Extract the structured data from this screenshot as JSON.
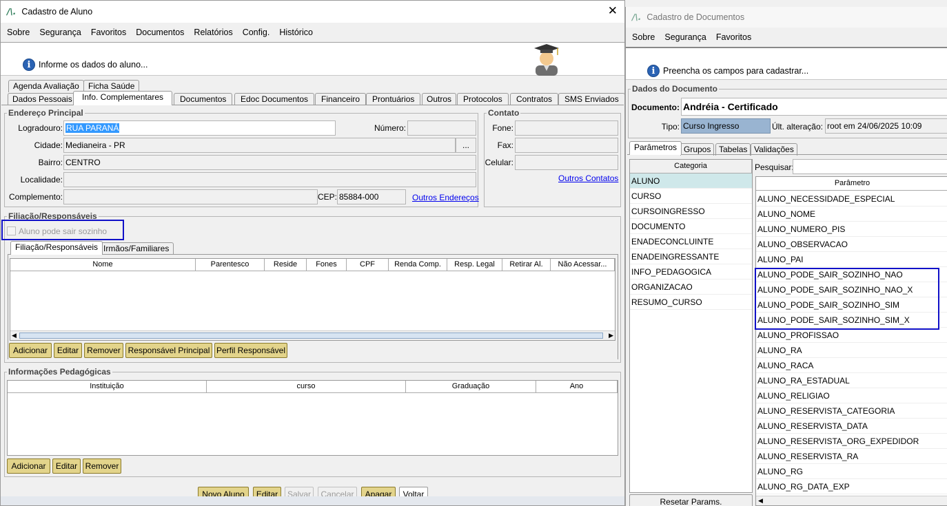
{
  "left": {
    "title": "Cadastro de Aluno",
    "menu": [
      "Sobre",
      "Segurança",
      "Favoritos",
      "Documentos",
      "Relatórios",
      "Config.",
      "Histórico"
    ],
    "banner_text": "Informe os dados do aluno...",
    "tabs_row1": [
      "Agenda Avaliação",
      "Ficha Saúde"
    ],
    "tabs_row2": [
      "Dados Pessoais",
      "Info. Complementares",
      "Documentos",
      "Edoc Documentos",
      "Financeiro",
      "Prontuários",
      "Outros",
      "Protocolos",
      "Contratos",
      "SMS Enviados"
    ],
    "endereco": {
      "legend": "Endereço Principal",
      "logradouro_label": "Logradouro:",
      "logradouro": "RUA PARANÁ",
      "numero_label": "Número:",
      "numero": "",
      "cidade_label": "Cidade:",
      "cidade": "Medianeira - PR",
      "cidade_btn": "...",
      "bairro_label": "Bairro:",
      "bairro": "CENTRO",
      "localidade_label": "Localidade:",
      "localidade": "",
      "complemento_label": "Complemento:",
      "complemento": "",
      "cep_label": "CEP:",
      "cep": "85884-000",
      "outros_enderecos": "Outros Endereços"
    },
    "contato": {
      "legend": "Contato",
      "fone_label": "Fone:",
      "fax_label": "Fax:",
      "celular_label": "Celular:",
      "outros_contatos": "Outros Contatos"
    },
    "filiacao": {
      "legend": "Filiação/Responsáveis",
      "checkbox_label": "Aluno pode sair sozinho",
      "tabs": [
        "Filiação/Responsáveis",
        "Irmãos/Familiares"
      ],
      "columns": [
        "Nome",
        "Parentesco",
        "Reside",
        "Fones",
        "CPF",
        "Renda Comp.",
        "Resp. Legal",
        "Retirar Al.",
        "Não Acessar..."
      ],
      "buttons": [
        "Adicionar",
        "Editar",
        "Remover",
        "Responsável Principal",
        "Perfil Responsável"
      ]
    },
    "pedagogicas": {
      "legend": "Informações Pedagógicas",
      "columns": [
        "Instituição",
        "curso",
        "Graduação",
        "Ano"
      ],
      "buttons": [
        "Adicionar",
        "Editar",
        "Remover"
      ]
    },
    "footer_buttons": [
      "Novo Aluno",
      "Editar",
      "Salvar",
      "Cancelar",
      "Apagar",
      "Voltar"
    ]
  },
  "right": {
    "title": "Cadastro de Documentos",
    "menu": [
      "Sobre",
      "Segurança",
      "Favoritos"
    ],
    "banner_text": "Preencha os campos para cadastrar...",
    "legend": "Dados do Documento",
    "documento_label": "Documento:",
    "documento": "Andréia - Certificado",
    "tipo_label": "Tipo:",
    "tipo": "Curso Ingresso",
    "ult_label": "Últ. alteração:",
    "ult": "root em 24/06/2025 10:09",
    "tabs": [
      "Parâmetros",
      "Grupos",
      "Tabelas",
      "Validações"
    ],
    "categoria_header": "Categoria",
    "categorias": [
      "ALUNO",
      "CURSO",
      "CURSOINGRESSO",
      "DOCUMENTO",
      "ENADECONCLUINTE",
      "ENADEINGRESSANTE",
      "INFO_PEDAGOGICA",
      "ORGANIZACAO",
      "RESUMO_CURSO"
    ],
    "pesquisar_label": "Pesquisar:",
    "parametro_header": "Parâmetro",
    "parametros": [
      "ALUNO_NECESSIDADE_ESPECIAL",
      "ALUNO_NOME",
      "ALUNO_NUMERO_PIS",
      "ALUNO_OBSERVACAO",
      "ALUNO_PAI",
      "ALUNO_PODE_SAIR_SOZINHO_NAO",
      "ALUNO_PODE_SAIR_SOZINHO_NAO_X",
      "ALUNO_PODE_SAIR_SOZINHO_SIM",
      "ALUNO_PODE_SAIR_SOZINHO_SIM_X",
      "ALUNO_PROFISSAO",
      "ALUNO_RA",
      "ALUNO_RACA",
      "ALUNO_RA_ESTADUAL",
      "ALUNO_RELIGIAO",
      "ALUNO_RESERVISTA_CATEGORIA",
      "ALUNO_RESERVISTA_DATA",
      "ALUNO_RESERVISTA_ORG_EXPEDIDOR",
      "ALUNO_RESERVISTA_RA",
      "ALUNO_RG",
      "ALUNO_RG_DATA_EXP"
    ],
    "reset_button": "Resetar Params."
  },
  "colors": {
    "highlight_border": "#1010c8",
    "button_bg": "#e3d48b",
    "selected_field": "#3399ff",
    "tipo_bg": "#99b4d1"
  }
}
